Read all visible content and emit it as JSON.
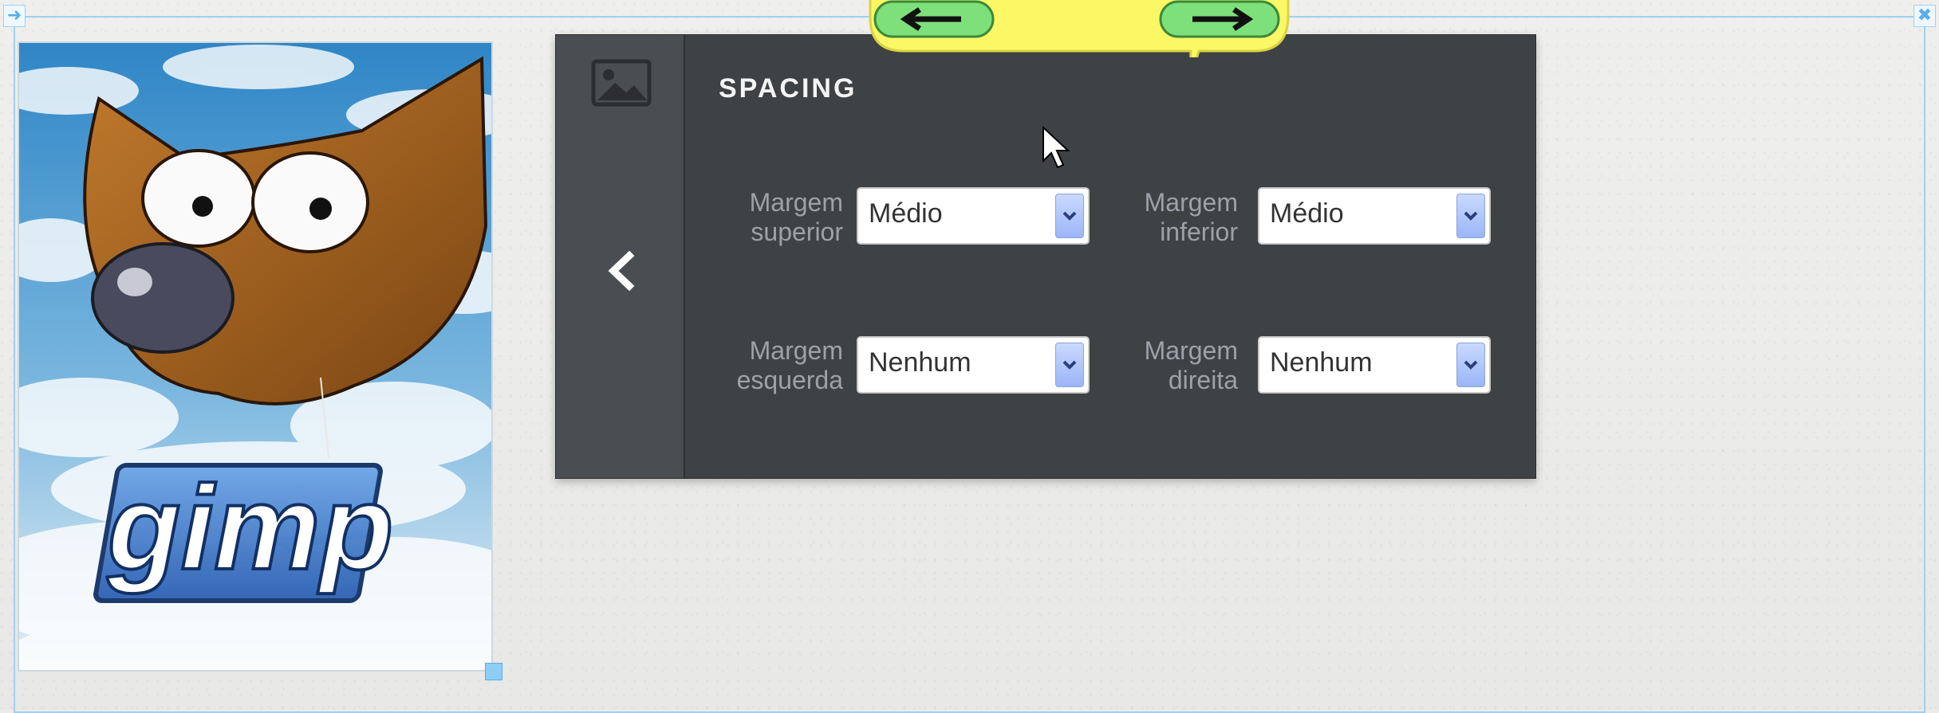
{
  "panel": {
    "title": "SPACING",
    "fields": [
      {
        "label_line1": "Margem",
        "label_line2": "superior",
        "value": "Médio"
      },
      {
        "label_line1": "Margem",
        "label_line2": "inferior",
        "value": "Médio"
      },
      {
        "label_line1": "Margem",
        "label_line2": "esquerda",
        "value": "Nenhum"
      },
      {
        "label_line1": "Margem",
        "label_line2": "direita",
        "value": "Nenhum"
      }
    ],
    "side_icon": "image-icon",
    "back_icon": "chevron-left-icon"
  },
  "image": {
    "logo_text": "gimp"
  },
  "nav": {
    "prev_icon": "arrow-left-icon",
    "next_icon": "arrow-right-icon"
  },
  "colors": {
    "panel_bg": "#3f4245",
    "panel_side_bg": "#4a4d51",
    "frame_border": "#9fd0f4",
    "bubble_yellow": "#fbf765",
    "nav_green": "#7ee07a",
    "select_arrow_blue": "#a9c0fa"
  }
}
